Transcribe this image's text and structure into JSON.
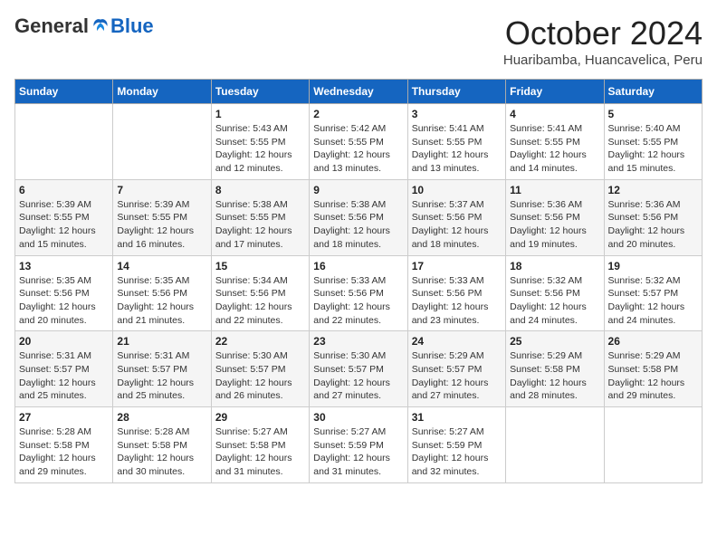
{
  "header": {
    "logo": {
      "general": "General",
      "blue": "Blue"
    },
    "title": "October 2024",
    "location": "Huaribamba, Huancavelica, Peru"
  },
  "weekdays": [
    "Sunday",
    "Monday",
    "Tuesday",
    "Wednesday",
    "Thursday",
    "Friday",
    "Saturday"
  ],
  "weeks": [
    [
      {
        "day": null
      },
      {
        "day": null
      },
      {
        "day": 1,
        "sunrise": "5:43 AM",
        "sunset": "5:55 PM",
        "daylight": "12 hours and 12 minutes."
      },
      {
        "day": 2,
        "sunrise": "5:42 AM",
        "sunset": "5:55 PM",
        "daylight": "12 hours and 13 minutes."
      },
      {
        "day": 3,
        "sunrise": "5:41 AM",
        "sunset": "5:55 PM",
        "daylight": "12 hours and 13 minutes."
      },
      {
        "day": 4,
        "sunrise": "5:41 AM",
        "sunset": "5:55 PM",
        "daylight": "12 hours and 14 minutes."
      },
      {
        "day": 5,
        "sunrise": "5:40 AM",
        "sunset": "5:55 PM",
        "daylight": "12 hours and 15 minutes."
      }
    ],
    [
      {
        "day": 6,
        "sunrise": "5:39 AM",
        "sunset": "5:55 PM",
        "daylight": "12 hours and 15 minutes."
      },
      {
        "day": 7,
        "sunrise": "5:39 AM",
        "sunset": "5:55 PM",
        "daylight": "12 hours and 16 minutes."
      },
      {
        "day": 8,
        "sunrise": "5:38 AM",
        "sunset": "5:55 PM",
        "daylight": "12 hours and 17 minutes."
      },
      {
        "day": 9,
        "sunrise": "5:38 AM",
        "sunset": "5:56 PM",
        "daylight": "12 hours and 18 minutes."
      },
      {
        "day": 10,
        "sunrise": "5:37 AM",
        "sunset": "5:56 PM",
        "daylight": "12 hours and 18 minutes."
      },
      {
        "day": 11,
        "sunrise": "5:36 AM",
        "sunset": "5:56 PM",
        "daylight": "12 hours and 19 minutes."
      },
      {
        "day": 12,
        "sunrise": "5:36 AM",
        "sunset": "5:56 PM",
        "daylight": "12 hours and 20 minutes."
      }
    ],
    [
      {
        "day": 13,
        "sunrise": "5:35 AM",
        "sunset": "5:56 PM",
        "daylight": "12 hours and 20 minutes."
      },
      {
        "day": 14,
        "sunrise": "5:35 AM",
        "sunset": "5:56 PM",
        "daylight": "12 hours and 21 minutes."
      },
      {
        "day": 15,
        "sunrise": "5:34 AM",
        "sunset": "5:56 PM",
        "daylight": "12 hours and 22 minutes."
      },
      {
        "day": 16,
        "sunrise": "5:33 AM",
        "sunset": "5:56 PM",
        "daylight": "12 hours and 22 minutes."
      },
      {
        "day": 17,
        "sunrise": "5:33 AM",
        "sunset": "5:56 PM",
        "daylight": "12 hours and 23 minutes."
      },
      {
        "day": 18,
        "sunrise": "5:32 AM",
        "sunset": "5:56 PM",
        "daylight": "12 hours and 24 minutes."
      },
      {
        "day": 19,
        "sunrise": "5:32 AM",
        "sunset": "5:57 PM",
        "daylight": "12 hours and 24 minutes."
      }
    ],
    [
      {
        "day": 20,
        "sunrise": "5:31 AM",
        "sunset": "5:57 PM",
        "daylight": "12 hours and 25 minutes."
      },
      {
        "day": 21,
        "sunrise": "5:31 AM",
        "sunset": "5:57 PM",
        "daylight": "12 hours and 25 minutes."
      },
      {
        "day": 22,
        "sunrise": "5:30 AM",
        "sunset": "5:57 PM",
        "daylight": "12 hours and 26 minutes."
      },
      {
        "day": 23,
        "sunrise": "5:30 AM",
        "sunset": "5:57 PM",
        "daylight": "12 hours and 27 minutes."
      },
      {
        "day": 24,
        "sunrise": "5:29 AM",
        "sunset": "5:57 PM",
        "daylight": "12 hours and 27 minutes."
      },
      {
        "day": 25,
        "sunrise": "5:29 AM",
        "sunset": "5:58 PM",
        "daylight": "12 hours and 28 minutes."
      },
      {
        "day": 26,
        "sunrise": "5:29 AM",
        "sunset": "5:58 PM",
        "daylight": "12 hours and 29 minutes."
      }
    ],
    [
      {
        "day": 27,
        "sunrise": "5:28 AM",
        "sunset": "5:58 PM",
        "daylight": "12 hours and 29 minutes."
      },
      {
        "day": 28,
        "sunrise": "5:28 AM",
        "sunset": "5:58 PM",
        "daylight": "12 hours and 30 minutes."
      },
      {
        "day": 29,
        "sunrise": "5:27 AM",
        "sunset": "5:58 PM",
        "daylight": "12 hours and 31 minutes."
      },
      {
        "day": 30,
        "sunrise": "5:27 AM",
        "sunset": "5:59 PM",
        "daylight": "12 hours and 31 minutes."
      },
      {
        "day": 31,
        "sunrise": "5:27 AM",
        "sunset": "5:59 PM",
        "daylight": "12 hours and 32 minutes."
      },
      {
        "day": null
      },
      {
        "day": null
      }
    ]
  ]
}
